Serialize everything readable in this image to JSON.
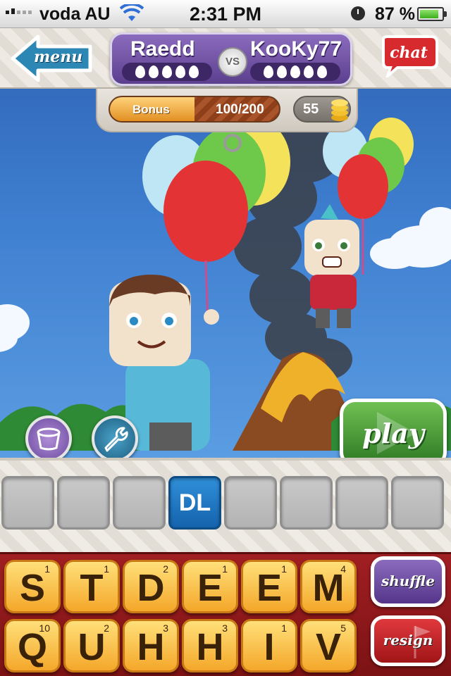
{
  "status_bar": {
    "carrier": "voda AU",
    "time": "2:31 PM",
    "battery_percent": "87 %"
  },
  "header": {
    "menu_label": "menu",
    "chat_label": "chat",
    "vs_label": "VS",
    "player_left": "Raedd",
    "player_right": "KooKy77"
  },
  "bonus": {
    "label": "Bonus",
    "value": "100/200",
    "progress_fraction": 0.5,
    "coins": "55"
  },
  "board": {
    "slots": [
      "",
      "",
      "",
      "DL",
      "",
      "",
      "",
      ""
    ]
  },
  "actions": {
    "play_label": "play",
    "shuffle_label": "shuffle",
    "resign_label": "resign"
  },
  "rack": {
    "row1": [
      {
        "letter": "S",
        "points": "1"
      },
      {
        "letter": "T",
        "points": "1"
      },
      {
        "letter": "D",
        "points": "2"
      },
      {
        "letter": "E",
        "points": "1"
      },
      {
        "letter": "E",
        "points": "1"
      },
      {
        "letter": "M",
        "points": "4"
      }
    ],
    "row2": [
      {
        "letter": "Q",
        "points": "10"
      },
      {
        "letter": "U",
        "points": "2"
      },
      {
        "letter": "H",
        "points": "3"
      },
      {
        "letter": "H",
        "points": "3"
      },
      {
        "letter": "I",
        "points": "1"
      },
      {
        "letter": "V",
        "points": "5"
      }
    ]
  }
}
